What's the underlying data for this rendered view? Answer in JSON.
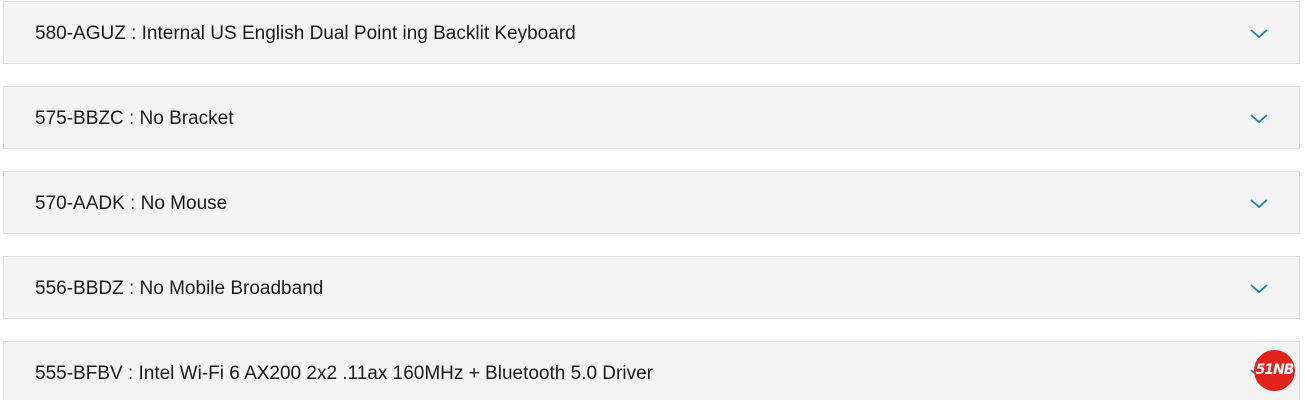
{
  "accordion": {
    "items": [
      {
        "label": "580-AGUZ : Internal US English Dual Point ing Backlit Keyboard",
        "expanded": false,
        "toggle_icon": "chevron-down-icon"
      },
      {
        "label": "575-BBZC : No Bracket",
        "expanded": false,
        "toggle_icon": "chevron-down-icon"
      },
      {
        "label": "570-AADK : No Mouse",
        "expanded": false,
        "toggle_icon": "chevron-down-icon"
      },
      {
        "label": "556-BBDZ : No Mobile Broadband",
        "expanded": false,
        "toggle_icon": "chevron-down-icon"
      },
      {
        "label": "555-BFBV : Intel Wi-Fi 6 AX200 2x2 .11ax 160MHz + Bluetooth 5.0 Driver",
        "expanded": false,
        "toggle_icon": "chevron-down-icon"
      }
    ]
  },
  "watermark": {
    "text": "51NB"
  },
  "colors": {
    "item_background": "#f4f4f4",
    "item_border": "#dedede",
    "chevron": "#1a7fc4",
    "text": "#1a1a1a",
    "watermark": "#e2231a"
  }
}
